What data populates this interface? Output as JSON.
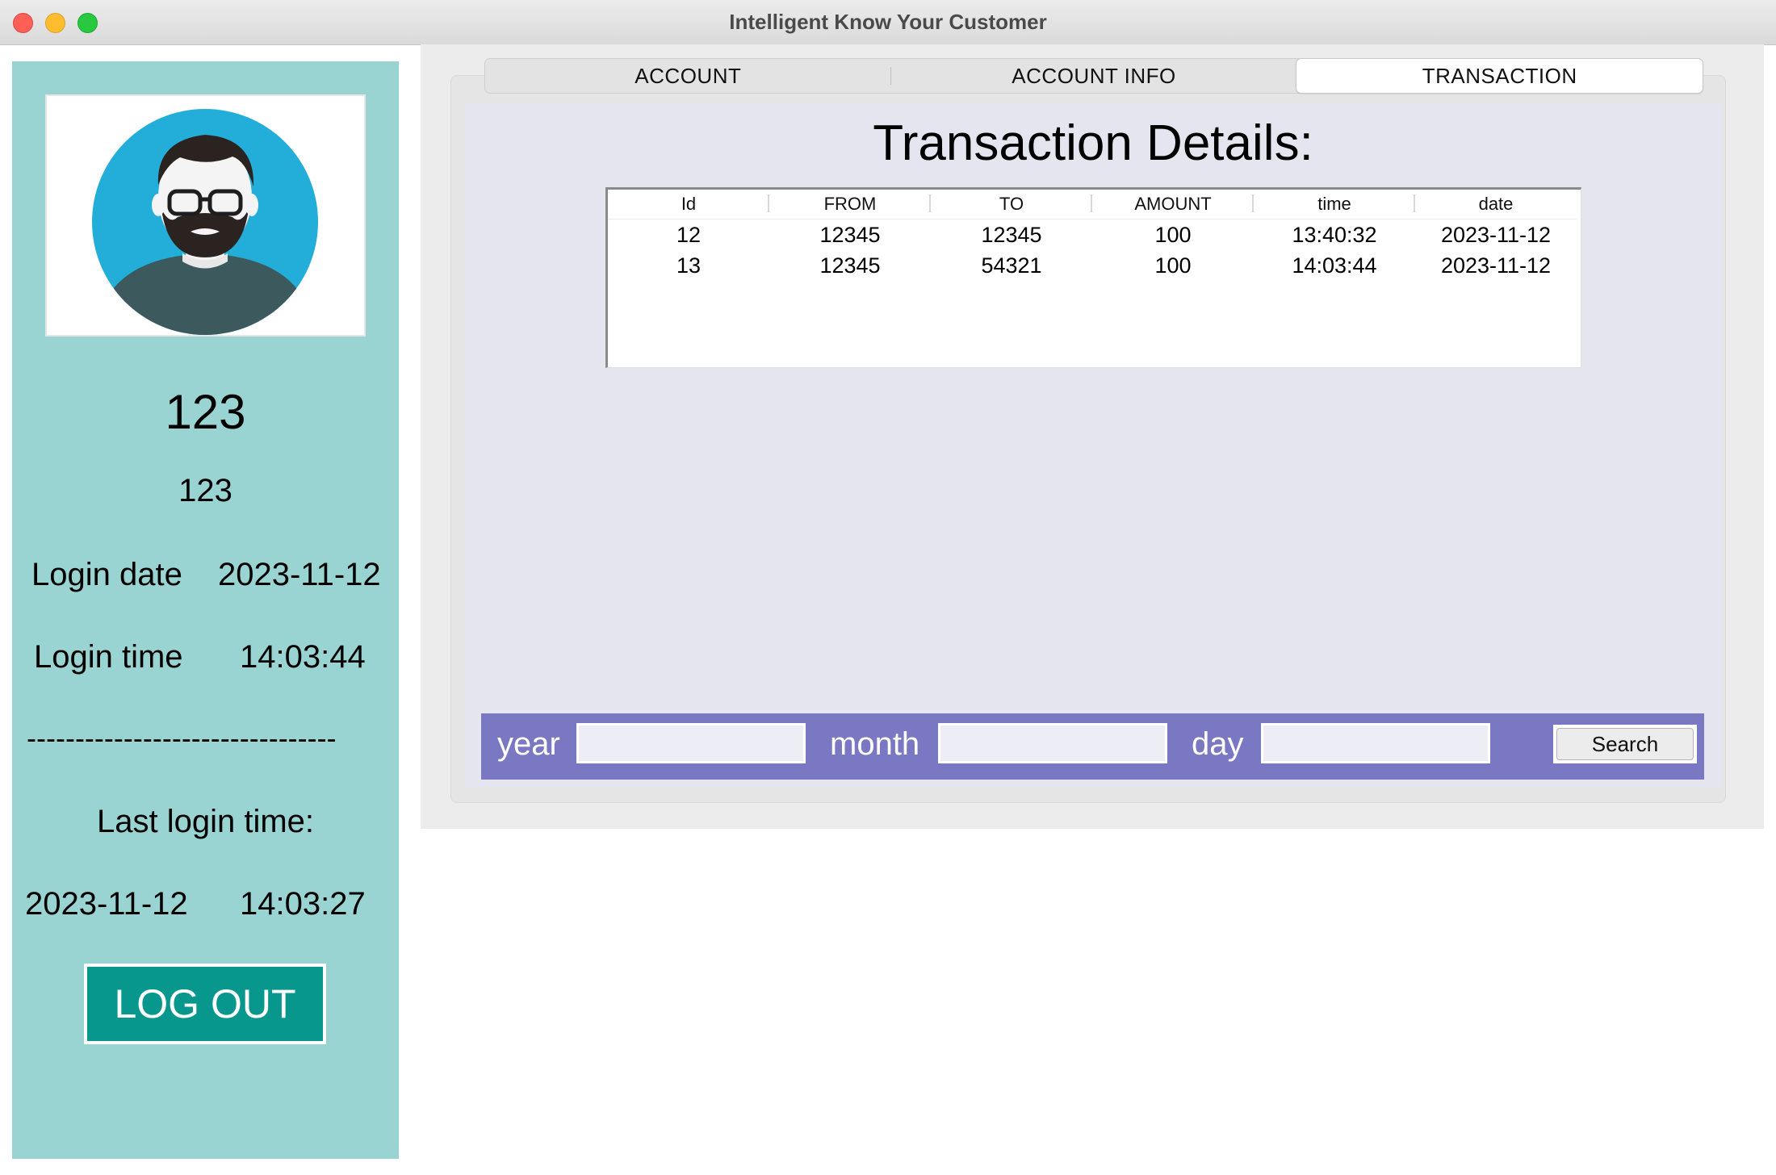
{
  "window": {
    "title": "Intelligent Know Your Customer"
  },
  "sidebar": {
    "avatar_icon": "user-avatar-icon",
    "account_number": "123",
    "username": "123",
    "login_date_label": "Login date",
    "login_date": "2023-11-12",
    "login_time_label": "Login time",
    "login_time": "14:03:44",
    "divider": "--------------------------------",
    "last_login_label": "Last login time:",
    "last_login_date": "2023-11-12",
    "last_login_time": "14:03:27",
    "logout_label": "LOG OUT",
    "background_color": "#99d4d2",
    "logout_color": "#08978c"
  },
  "tabs": [
    {
      "label": "ACCOUNT",
      "active": false
    },
    {
      "label": "ACCOUNT INFO",
      "active": false
    },
    {
      "label": "TRANSACTION",
      "active": true
    }
  ],
  "transaction": {
    "title": "Transaction Details:",
    "columns": [
      "Id",
      "FROM",
      "TO",
      "AMOUNT",
      "time",
      "date"
    ],
    "rows": [
      [
        "12",
        "12345",
        "12345",
        "100",
        "13:40:32",
        "2023-11-12"
      ],
      [
        "13",
        "12345",
        "54321",
        "100",
        "14:03:44",
        "2023-11-12"
      ]
    ]
  },
  "search": {
    "year_label": "year",
    "year_value": "",
    "month_label": "month",
    "month_value": "",
    "day_label": "day",
    "day_value": "",
    "button_label": "Search",
    "bar_color": "#7a77c3"
  }
}
